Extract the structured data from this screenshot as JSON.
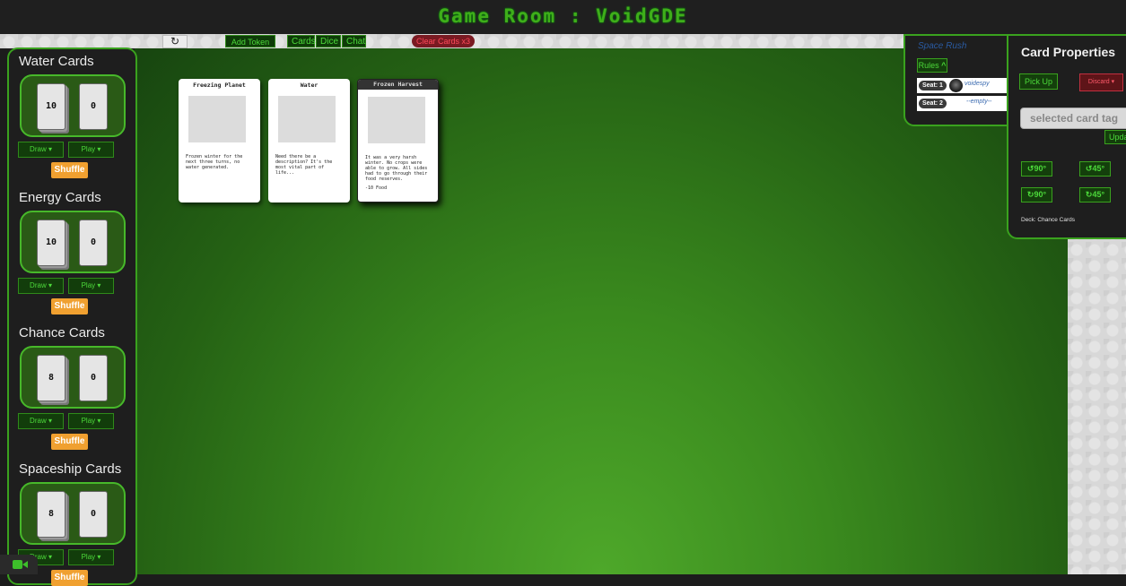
{
  "header": {
    "title": "Game Room : VoidGDE"
  },
  "toolbar": {
    "refresh_icon": "↻",
    "add_token_label": "Add Token ▾",
    "cards_label": "Cards",
    "dice_label": "Dice",
    "chat_label": "Chat",
    "clear_cards_label": "Clear Cards x3"
  },
  "decks": [
    {
      "title": "Water Cards",
      "draw_count": "10",
      "discard_count": "0",
      "draw_label": "Draw ▾",
      "play_label": "Play ▾",
      "shuffle_label": "Shuffle"
    },
    {
      "title": "Energy Cards",
      "draw_count": "10",
      "discard_count": "0",
      "draw_label": "Draw ▾",
      "play_label": "Play ▾",
      "shuffle_label": "Shuffle"
    },
    {
      "title": "Chance Cards",
      "draw_count": "8",
      "discard_count": "0",
      "draw_label": "Draw ▾",
      "play_label": "Play ▾",
      "shuffle_label": "Shuffle"
    },
    {
      "title": "Spaceship Cards",
      "draw_count": "8",
      "discard_count": "0",
      "draw_label": "Draw ▾",
      "play_label": "Play ▾",
      "shuffle_label": "Shuffle"
    }
  ],
  "table_cards": [
    {
      "title": "Freezing Planet",
      "description": "Frozen winter for the next three turns, no water generated."
    },
    {
      "title": "Water",
      "description": "Need there be a description? It's the most vital part of life..."
    },
    {
      "title": "Frozen Harvest",
      "description": "It was a very harsh winter. No crops were able to grow. All sides had to go through their food reserves.",
      "effect": "-10 Food"
    }
  ],
  "game": {
    "name": "Space Rush",
    "rules_label": "Rules",
    "rules_icon": "chevron-up-icon",
    "seats": [
      {
        "label": "Seat: 1",
        "user": "voidespy"
      },
      {
        "label": "Seat: 2",
        "user": "--empty--"
      }
    ]
  },
  "card_properties": {
    "title": "Card Properties",
    "pick_up_label": "Pick Up",
    "discard_label": "Discard ▾",
    "tag_placeholder": "selected card tag",
    "update_label": "Update",
    "rotate_ccw_90": "↺90°",
    "rotate_ccw_45": "↺45°",
    "rotate_cw_90": "↻90°",
    "rotate_cw_45": "↻45°",
    "deck_info": "Deck: Chance Cards"
  },
  "colors": {
    "accent_green": "#3aa21e",
    "table_green": "#3a8a1e",
    "shuffle_orange": "#f0a030",
    "danger_red": "#c03040"
  }
}
